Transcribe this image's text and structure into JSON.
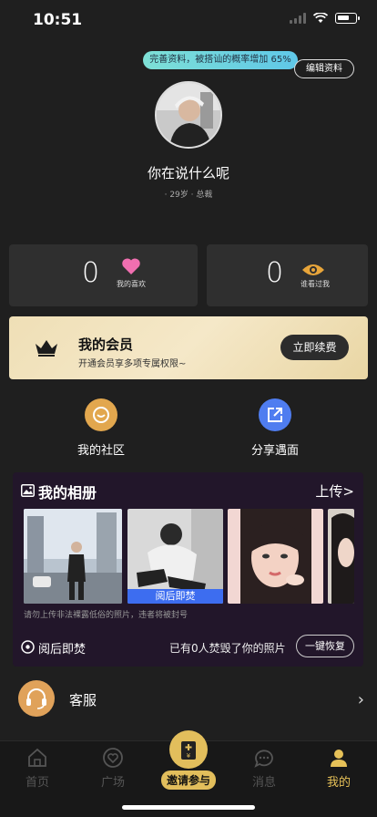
{
  "status_bar": {
    "time": "10:51"
  },
  "profile": {
    "tip_banner": "完善资料，被搭讪的概率增加 65%",
    "edit_label": "编辑资料",
    "username": "你在说什么呢",
    "meta": "· 29岁 · 总裁"
  },
  "stats": {
    "likes_count": "0",
    "likes_label": "我的喜欢",
    "viewers_count": "0",
    "viewers_label": "谁看过我"
  },
  "vip": {
    "title": "我的会员",
    "subtitle": "开通会员享多项专属权限~",
    "button": "立即续费"
  },
  "quick_links": {
    "community": "我的社区",
    "share": "分享遇面"
  },
  "album": {
    "title": "我的相册",
    "upload": "上传>",
    "burn_tag": "阅后即焚",
    "warning": "请勿上传非法裸露低俗的照片，违者将被封号",
    "burn_label": "阅后即焚",
    "burn_count": "已有0人焚毁了你的照片",
    "restore": "一键恢复"
  },
  "service": {
    "label": "客服"
  },
  "tabs": {
    "home": "首页",
    "square": "广场",
    "invite": "邀请参与",
    "messages": "消息",
    "mine": "我的"
  },
  "colors": {
    "gold": "#e6c158",
    "tip_gradient_start": "#7ee0d6",
    "tip_gradient_end": "#5fc7e8",
    "burn_blue": "#3d6df0",
    "album_bg": "#22162a"
  }
}
